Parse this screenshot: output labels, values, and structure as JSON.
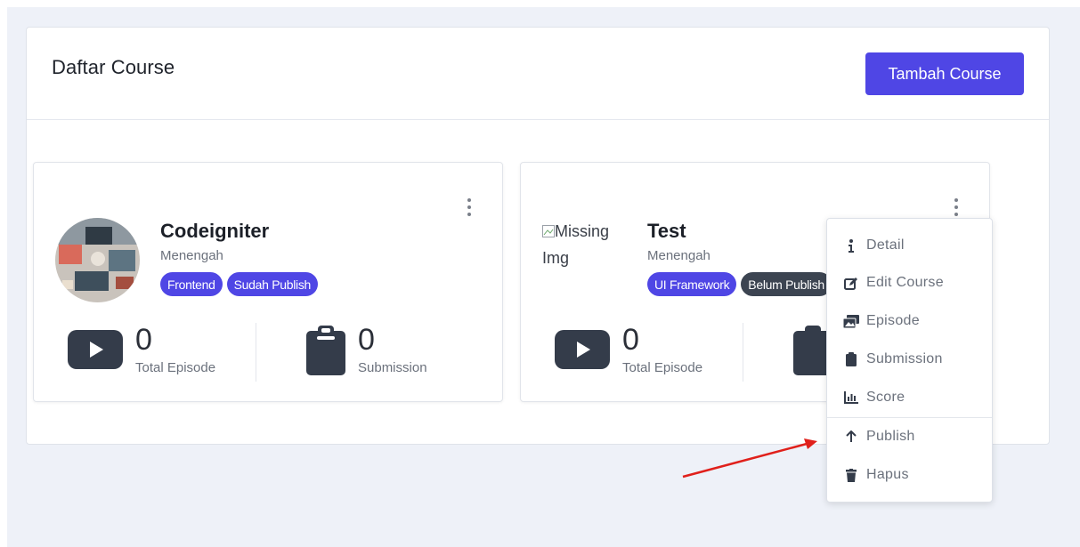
{
  "page": {
    "title": "Daftar Course",
    "add_button": "Tambah Course"
  },
  "courses": [
    {
      "name": "Codeigniter",
      "level": "Menengah",
      "badges": [
        "Frontend",
        "Sudah Publish"
      ],
      "total_episode": "0",
      "total_episode_label": "Total Episode",
      "submission": "0",
      "submission_label": "Submission"
    },
    {
      "name": "Test",
      "level": "Menengah",
      "image_alt": "Missing Img",
      "badges": [
        "UI Framework",
        "Belum Publish"
      ],
      "total_episode": "0",
      "total_episode_label": "Total Episode"
    }
  ],
  "menu": {
    "items": [
      {
        "label": "Detail",
        "icon": "info-icon"
      },
      {
        "label": "Edit Course",
        "icon": "edit-icon"
      },
      {
        "label": "Episode",
        "icon": "images-icon"
      },
      {
        "label": "Submission",
        "icon": "clipboard-icon"
      },
      {
        "label": "Score",
        "icon": "bar-chart-icon"
      },
      {
        "label": "Publish",
        "icon": "arrow-up-icon"
      },
      {
        "label": "Hapus",
        "icon": "trash-icon"
      }
    ]
  },
  "colors": {
    "primary": "#4f46e5",
    "badge_dark": "#3c4451",
    "icon_dark": "#343c4a",
    "annotation_arrow": "#e0201b"
  }
}
